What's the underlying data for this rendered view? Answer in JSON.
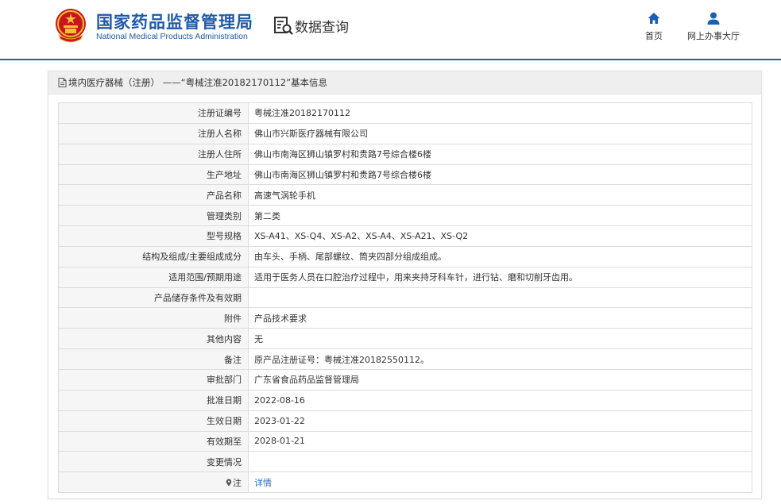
{
  "header": {
    "org_name_cn": "国家药品监督管理局",
    "org_name_en": "National Medical Products Administration",
    "query_title": "数据查询",
    "nav": [
      {
        "label": "首页",
        "icon": "home-icon"
      },
      {
        "label": "网上办事大厅",
        "icon": "user-icon"
      }
    ]
  },
  "panel": {
    "title": "境内医疗器械（注册） ——“粤械注准20182170112”基本信息",
    "title_icon": "document-icon"
  },
  "rows": [
    {
      "label": "注册证编号",
      "value": "粤械注准20182170112"
    },
    {
      "label": "注册人名称",
      "value": "佛山市兴斯医疗器械有限公司"
    },
    {
      "label": "注册人住所",
      "value": "佛山市南海区狮山镇罗村和贵路7号综合楼6楼"
    },
    {
      "label": "生产地址",
      "value": "佛山市南海区狮山镇罗村和贵路7号综合楼6楼"
    },
    {
      "label": "产品名称",
      "value": "高速气涡轮手机"
    },
    {
      "label": "管理类别",
      "value": "第二类"
    },
    {
      "label": "型号规格",
      "value": "XS-A41、XS-Q4、XS-A2、XS-A4、XS-A21、XS-Q2"
    },
    {
      "label": "结构及组成/主要组成成分",
      "value": "由车头、手柄、尾部螺纹、筒夹四部分组成组成。"
    },
    {
      "label": "适用范围/预期用途",
      "value": "适用于医务人员在口腔治疗过程中，用来夹持牙科车针，进行钻、磨和切削牙齿用。"
    },
    {
      "label": "产品储存条件及有效期",
      "value": ""
    },
    {
      "label": "附件",
      "value": "产品技术要求"
    },
    {
      "label": "其他内容",
      "value": "无"
    },
    {
      "label": "备注",
      "value": "原产品注册证号：粤械注准20182550112。"
    },
    {
      "label": "审批部门",
      "value": "广东省食品药品监督管理局"
    },
    {
      "label": "批准日期",
      "value": "2022-08-16"
    },
    {
      "label": "生效日期",
      "value": "2023-01-22"
    },
    {
      "label": "有效期至",
      "value": "2028-01-21"
    },
    {
      "label": "变更情况",
      "value": ""
    }
  ],
  "note_row": {
    "label": "注",
    "link": "详情",
    "icon": "pin-icon"
  },
  "colors": {
    "brand_blue": "#1f5aa8",
    "header_line": "#1a63b0",
    "link": "#2a6fc9"
  }
}
